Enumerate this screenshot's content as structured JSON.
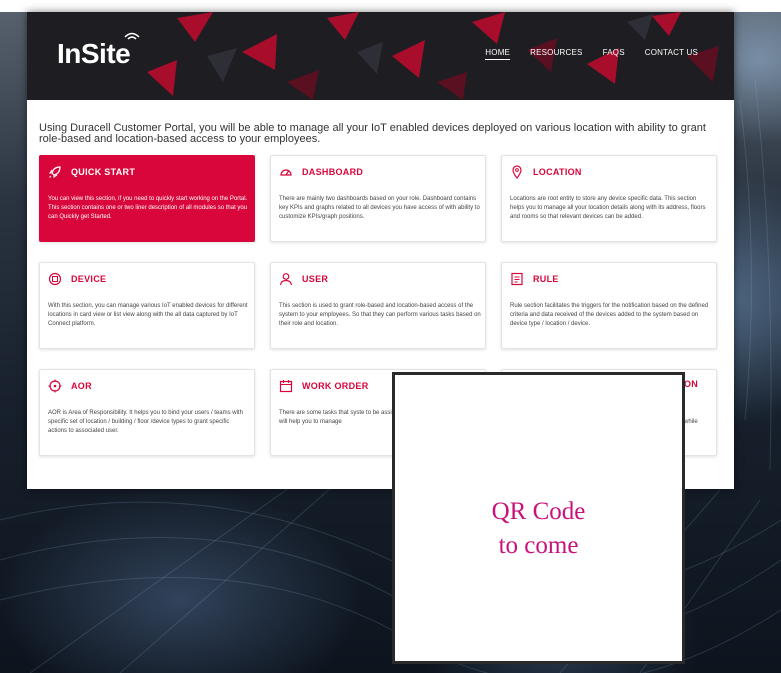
{
  "brand": {
    "logo_text": "InSite",
    "accent": "#d8063a",
    "header_bg": "#1d1d22"
  },
  "nav": [
    {
      "label": "HOME",
      "active": true
    },
    {
      "label": "RESOURCES",
      "active": false
    },
    {
      "label": "FAQS",
      "active": false
    },
    {
      "label": "CONTACT US",
      "active": false
    }
  ],
  "intro": "Using Duracell Customer Portal, you will be able to manage all your IoT enabled devices deployed on various location with ability to grant role-based and location-based access to your employees.",
  "cards": [
    {
      "title": "QUICK START",
      "icon": "rocket-icon",
      "active": true,
      "desc": "You can view this section, if you need to quickly start working on the Portal. This section contains one or two liner description of all modules so that you can Quickly get Started."
    },
    {
      "title": "DASHBOARD",
      "icon": "gauge-icon",
      "active": false,
      "desc": "There are mainly two dashboards based on your role. Dashboard contains key KPIs and graphs related to all devices you have access of with ability to customize KPIs/graph positions."
    },
    {
      "title": "LOCATION",
      "icon": "location-pin-icon",
      "active": false,
      "desc": "Locations are root entity to store any device specific data. This section helps you to manage all your location details along with its address, floors and rooms so that relevant devices can be added."
    },
    {
      "title": "DEVICE",
      "icon": "device-icon",
      "active": false,
      "desc": "With this section, you can manage various IoT enabled devices for different locations in card view or list view along with the all data captured by IoT Connect platform."
    },
    {
      "title": "USER",
      "icon": "user-icon",
      "active": false,
      "desc": "This section is used to grant role-based and location-based access of the system to your employees. So that they can perform various tasks based on their role and location."
    },
    {
      "title": "RULE",
      "icon": "rule-icon",
      "active": false,
      "desc": "Rule section facilitates the triggers for the notification based on the defined criteria and data received of the devices added to the system based on device type / location / device."
    },
    {
      "title": "AOR",
      "icon": "target-icon",
      "active": false,
      "desc": "AOR is Area of Responsibility. It helps you to bind your users / teams with specific set of location / building / floor /device types to grant specific actions to associated user."
    },
    {
      "title": "WORK ORDER",
      "icon": "calendar-icon",
      "active": false,
      "desc": "There are some tasks that syste to be assigned to relevant users section will help you to manage"
    },
    {
      "title": "ON",
      "icon": "",
      "active": false,
      "desc": "while"
    }
  ],
  "qr_overlay": {
    "line1": "QR Code",
    "line2": "to come",
    "color": "#c8127b"
  }
}
